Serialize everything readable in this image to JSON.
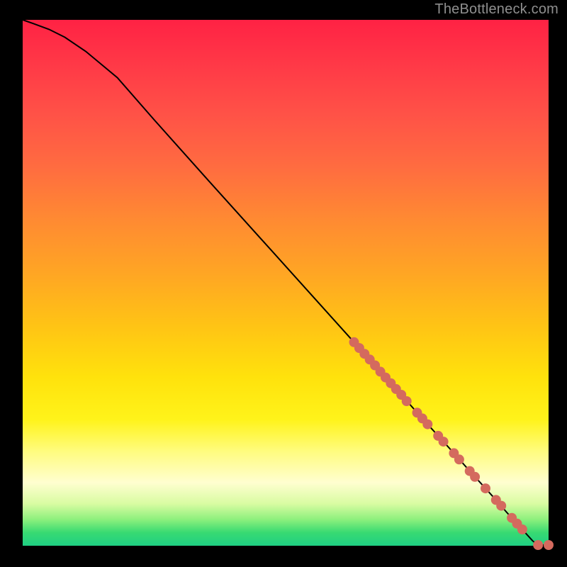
{
  "attribution": "TheBottleneck.com",
  "chart_data": {
    "type": "line",
    "title": "",
    "xlabel": "",
    "ylabel": "",
    "xlim": [
      0,
      100
    ],
    "ylim": [
      0,
      100
    ],
    "series": [
      {
        "name": "curve",
        "x": [
          0,
          2,
          5,
          8,
          12,
          18,
          25,
          35,
          45,
          55,
          63,
          68,
          72,
          76,
          79,
          82,
          85,
          88,
          90,
          92,
          94,
          95,
          96,
          97,
          98,
          100
        ],
        "y": [
          100,
          99.3,
          98.2,
          96.7,
          94.0,
          89.0,
          81.0,
          69.8,
          58.7,
          47.6,
          38.7,
          33.1,
          28.7,
          24.2,
          20.9,
          17.6,
          14.2,
          10.9,
          8.7,
          6.4,
          4.2,
          3.1,
          2.0,
          0.9,
          0.14,
          0.14
        ]
      }
    ],
    "highlight_points": {
      "name": "dots",
      "x": [
        63,
        64,
        65,
        66,
        67,
        68,
        69,
        70,
        71,
        72,
        73,
        75,
        76,
        77,
        79,
        80,
        82,
        83,
        85,
        86,
        88,
        90,
        91,
        93,
        94,
        95,
        98,
        100
      ],
      "y": [
        38.7,
        37.6,
        36.5,
        35.4,
        34.3,
        33.1,
        32.0,
        30.9,
        29.8,
        28.7,
        27.5,
        25.3,
        24.2,
        23.1,
        20.9,
        19.8,
        17.6,
        16.4,
        14.2,
        13.1,
        10.9,
        8.7,
        7.6,
        5.3,
        4.2,
        3.1,
        0.14,
        0.14
      ]
    },
    "background_gradient": {
      "top": "#ff2244",
      "mid": "#ffe20c",
      "bottom": "#1fcf83"
    }
  }
}
